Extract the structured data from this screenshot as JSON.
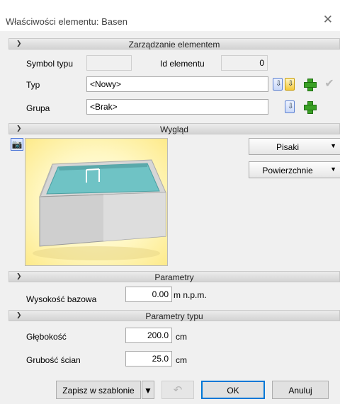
{
  "window": {
    "title": "Właściwości elementu: Basen"
  },
  "sections": {
    "management": "Zarządzanie elementem",
    "appearance": "Wygląd",
    "parameters": "Parametry",
    "type_parameters": "Parametry typu"
  },
  "management": {
    "type_symbol_label": "Symbol typu",
    "type_symbol_value": "",
    "element_id_label": "Id elementu",
    "element_id_value": "0",
    "type_label": "Typ",
    "type_value": "<Nowy>",
    "group_label": "Grupa",
    "group_value": "<Brak>"
  },
  "appearance": {
    "pens_button": "Pisaki",
    "surfaces_button": "Powierzchnie"
  },
  "parameters": {
    "base_height_label": "Wysokość bazowa",
    "base_height_value": "0.00",
    "base_height_unit": "m n.p.m."
  },
  "type_parameters": {
    "depth_label": "Głębokość",
    "depth_value": "200.0",
    "depth_unit": "cm",
    "wall_thickness_label": "Grubość ścian",
    "wall_thickness_value": "25.0",
    "wall_thickness_unit": "cm"
  },
  "footer": {
    "save_template": "Zapisz w szablonie",
    "ok": "OK",
    "cancel": "Anuluj"
  },
  "icons": {
    "close": "close-icon",
    "camera": "camera-icon",
    "undo": "undo-icon",
    "add": "plus-icon",
    "confirm": "check-icon"
  },
  "colors": {
    "section_header": "#d8d8d8",
    "preview_background": "#fdf0a8",
    "pool_water": "#6fc3c5",
    "default_button_border": "#0078d7",
    "add_icon": "#3aa025"
  }
}
